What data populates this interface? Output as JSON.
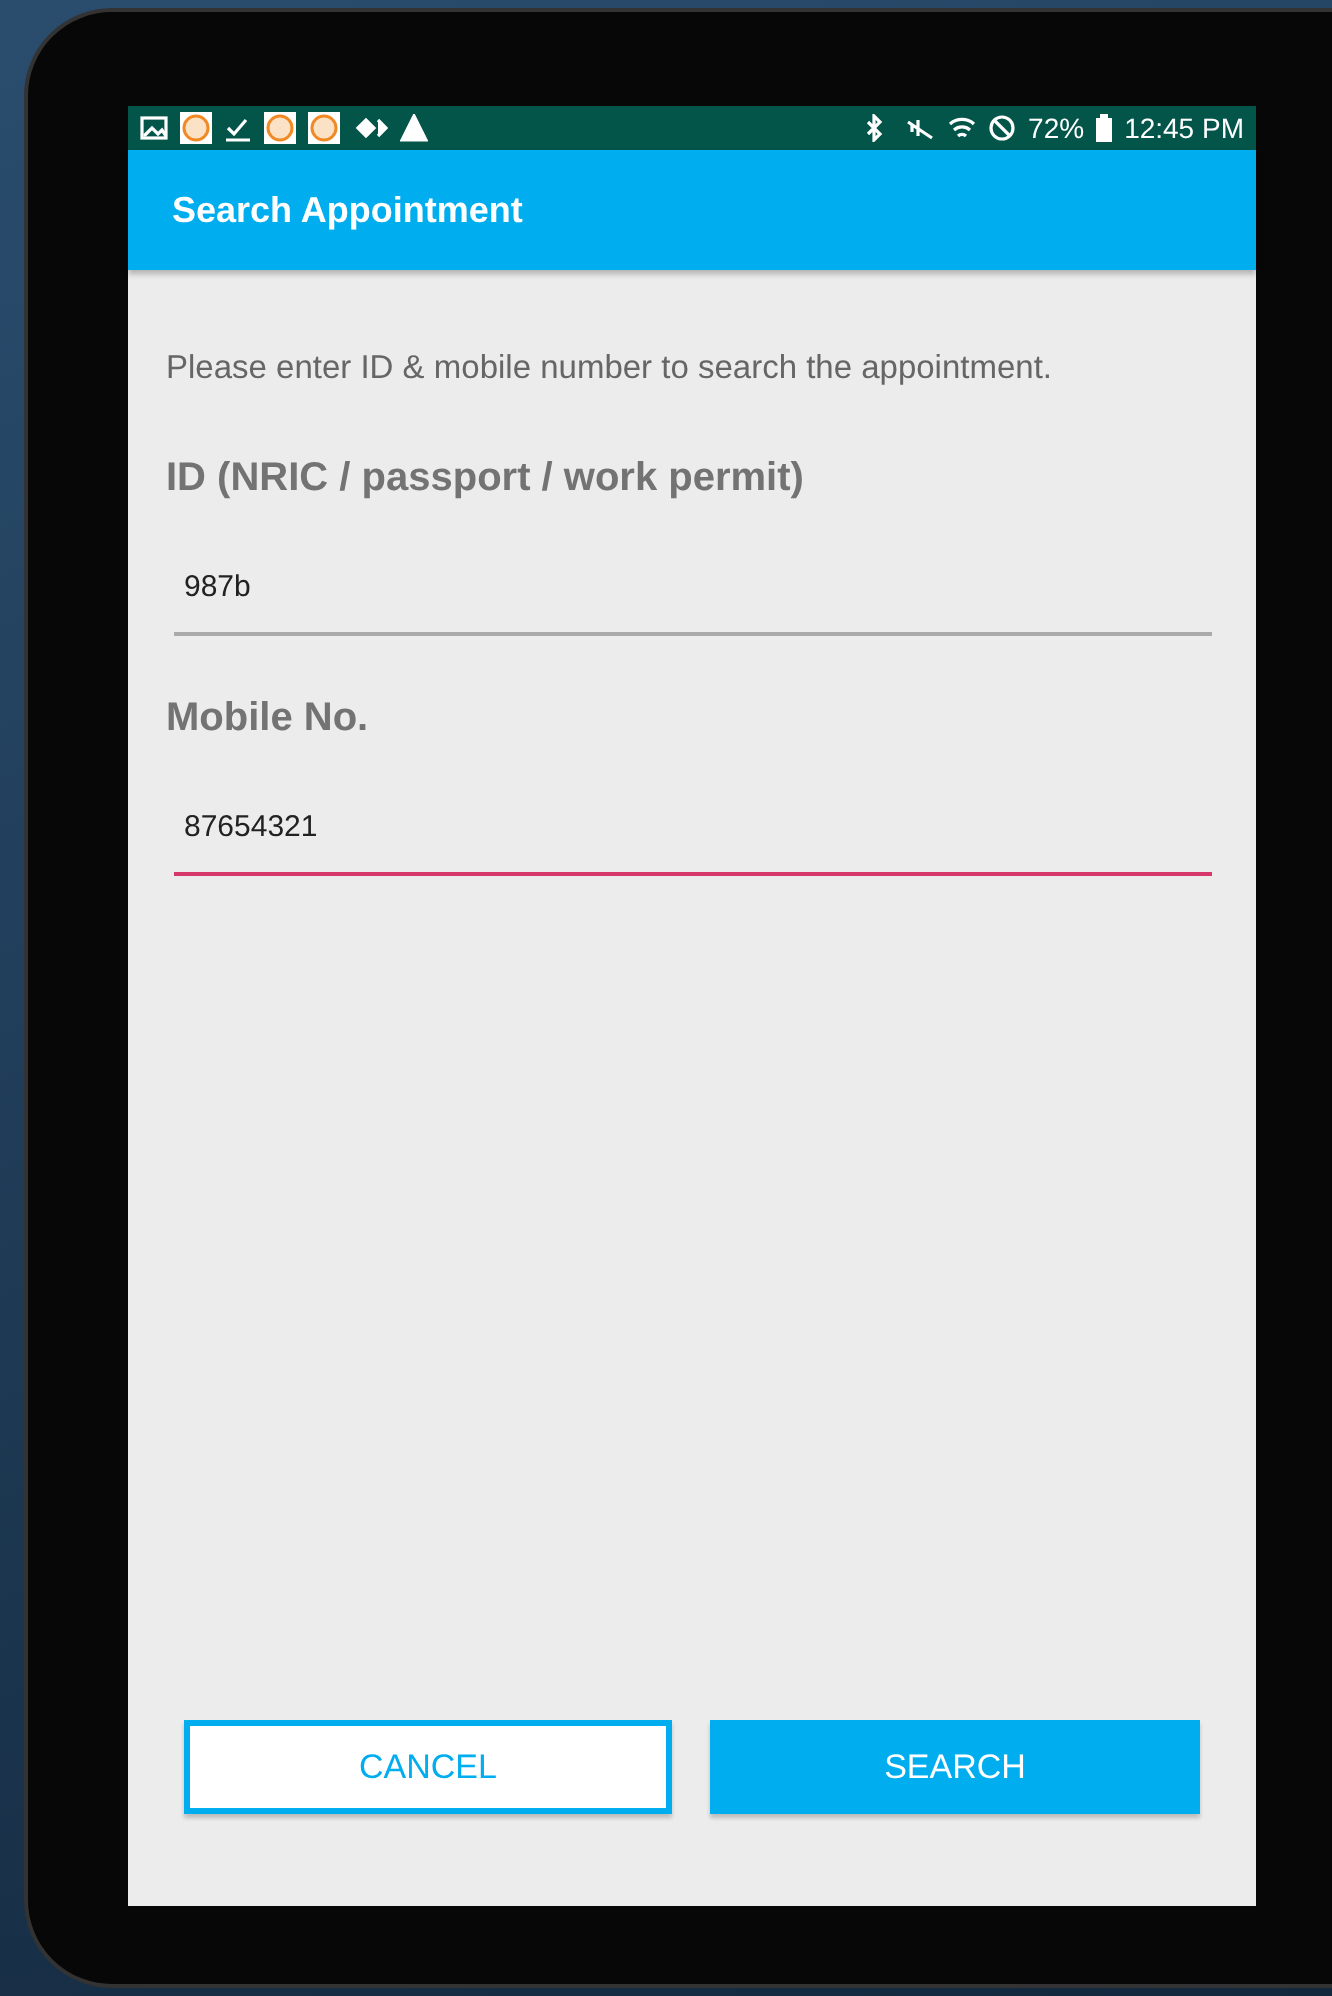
{
  "status_bar": {
    "battery": "72%",
    "time": "12:45 PM"
  },
  "app_bar": {
    "title": "Search Appointment"
  },
  "instruction": "Please enter ID & mobile number to search the appointment.",
  "fields": [
    {
      "label": "ID (NRIC / passport / work permit)",
      "value": "987b",
      "focused": false
    },
    {
      "label": "Mobile No.",
      "value": "87654321",
      "focused": true
    }
  ],
  "buttons": [
    {
      "label": "CANCEL",
      "kind": "outlined"
    },
    {
      "label": "SEARCH",
      "kind": "filled"
    }
  ]
}
